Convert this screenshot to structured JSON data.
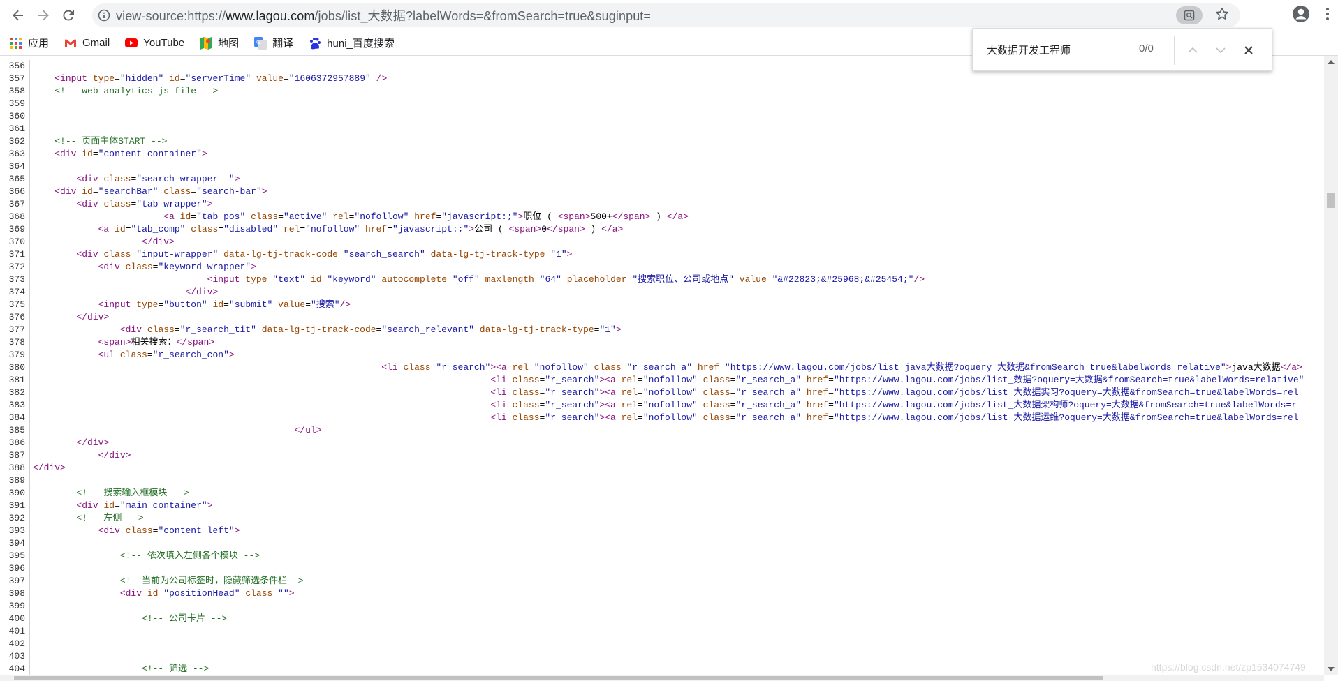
{
  "browser": {
    "url_prefix": "view-source:https://",
    "url_host": "www.lagou.com",
    "url_path": "/jobs/list_大数据?labelWords=&fromSearch=true&suginput="
  },
  "bookmarks": [
    {
      "label": "应用",
      "icon": "apps-grid-icon"
    },
    {
      "label": "Gmail",
      "icon": "gmail-icon"
    },
    {
      "label": "YouTube",
      "icon": "youtube-icon"
    },
    {
      "label": "地图",
      "icon": "maps-icon"
    },
    {
      "label": "翻译",
      "icon": "translate-icon"
    },
    {
      "label": "huni_百度搜索",
      "icon": "baidu-icon"
    }
  ],
  "find_bar": {
    "query": "大数据开发工程师",
    "count": "0/0"
  },
  "watermark": "https://blog.csdn.net/zp1534074749",
  "source_lines": [
    {
      "n": "356",
      "code": ""
    },
    {
      "n": "357",
      "code": "    <input type=\"hidden\" id=\"serverTime\" value=\"1606372957889\" />"
    },
    {
      "n": "358",
      "code": "    <!-- web analytics js file -->"
    },
    {
      "n": "359",
      "code": ""
    },
    {
      "n": "360",
      "code": ""
    },
    {
      "n": "361",
      "code": ""
    },
    {
      "n": "362",
      "code": "    <!-- 页面主体START -->"
    },
    {
      "n": "363",
      "code": "    <div id=\"content-container\">"
    },
    {
      "n": "364",
      "code": ""
    },
    {
      "n": "365",
      "code": "        <div class=\"search-wrapper  \">"
    },
    {
      "n": "366",
      "code": "    <div id=\"searchBar\" class=\"search-bar\">"
    },
    {
      "n": "367",
      "code": "        <div class=\"tab-wrapper\">"
    },
    {
      "n": "368",
      "code": "                        <a id=\"tab_pos\" class=\"active\" rel=\"nofollow\" href=\"javascript:;\">职位 ( <span>500+</span> ) </a>"
    },
    {
      "n": "369",
      "code": "            <a id=\"tab_comp\" class=\"disabled\" rel=\"nofollow\" href=\"javascript:;\">公司 ( <span>0</span> ) </a>"
    },
    {
      "n": "370",
      "code": "                    </div>"
    },
    {
      "n": "371",
      "code": "        <div class=\"input-wrapper\" data-lg-tj-track-code=\"search_search\" data-lg-tj-track-type=\"1\">"
    },
    {
      "n": "372",
      "code": "            <div class=\"keyword-wrapper\">"
    },
    {
      "n": "373",
      "code": "                                <input type=\"text\" id=\"keyword\" autocomplete=\"off\" maxlength=\"64\" placeholder=\"搜索职位、公司或地点\" value=\"&#22823;&#25968;&#25454;\"/>"
    },
    {
      "n": "374",
      "code": "                            </div>"
    },
    {
      "n": "375",
      "code": "            <input type=\"button\" id=\"submit\" value=\"搜索\"/>"
    },
    {
      "n": "376",
      "code": "        </div>"
    },
    {
      "n": "377",
      "code": "                <div class=\"r_search_tit\" data-lg-tj-track-code=\"search_relevant\" data-lg-tj-track-type=\"1\">"
    },
    {
      "n": "378",
      "code": "            <span>相关搜索：</span>"
    },
    {
      "n": "379",
      "code": "            <ul class=\"r_search_con\">"
    },
    {
      "n": "380",
      "code": "                                                                <li class=\"r_search\"><a rel=\"nofollow\" class=\"r_search_a\" href=\"https://www.lagou.com/jobs/list_java大数据?oquery=大数据&fromSearch=true&labelWords=relative\">java大数据</a>"
    },
    {
      "n": "381",
      "code": "                                                                                    <li class=\"r_search\"><a rel=\"nofollow\" class=\"r_search_a\" href=\"https://www.lagou.com/jobs/list_数据?oquery=大数据&fromSearch=true&labelWords=relative\""
    },
    {
      "n": "382",
      "code": "                                                                                    <li class=\"r_search\"><a rel=\"nofollow\" class=\"r_search_a\" href=\"https://www.lagou.com/jobs/list_大数据实习?oquery=大数据&fromSearch=true&labelWords=rel"
    },
    {
      "n": "383",
      "code": "                                                                                    <li class=\"r_search\"><a rel=\"nofollow\" class=\"r_search_a\" href=\"https://www.lagou.com/jobs/list_大数据架构师?oquery=大数据&fromSearch=true&labelWords=r"
    },
    {
      "n": "384",
      "code": "                                                                                    <li class=\"r_search\"><a rel=\"nofollow\" class=\"r_search_a\" href=\"https://www.lagou.com/jobs/list_大数据运维?oquery=大数据&fromSearch=true&labelWords=rel"
    },
    {
      "n": "385",
      "code": "                                                </ul>"
    },
    {
      "n": "386",
      "code": "        </div>"
    },
    {
      "n": "387",
      "code": "            </div>"
    },
    {
      "n": "388",
      "code": "</div>"
    },
    {
      "n": "389",
      "code": ""
    },
    {
      "n": "390",
      "code": "        <!-- 搜索输入框模块 -->"
    },
    {
      "n": "391",
      "code": "        <div id=\"main_container\">"
    },
    {
      "n": "392",
      "code": "        <!-- 左侧 -->"
    },
    {
      "n": "393",
      "code": "            <div class=\"content_left\">"
    },
    {
      "n": "394",
      "code": ""
    },
    {
      "n": "395",
      "code": "                <!-- 依次填入左侧各个模块 -->"
    },
    {
      "n": "396",
      "code": ""
    },
    {
      "n": "397",
      "code": "                <!--当前为公司标签时，隐藏筛选条件栏-->"
    },
    {
      "n": "398",
      "code": "                <div id=\"positionHead\" class=\"\">"
    },
    {
      "n": "399",
      "code": ""
    },
    {
      "n": "400",
      "code": "                    <!-- 公司卡片 -->"
    },
    {
      "n": "401",
      "code": ""
    },
    {
      "n": "402",
      "code": ""
    },
    {
      "n": "403",
      "code": ""
    },
    {
      "n": "404",
      "code": "                    <!-- 筛选 -->"
    }
  ]
}
